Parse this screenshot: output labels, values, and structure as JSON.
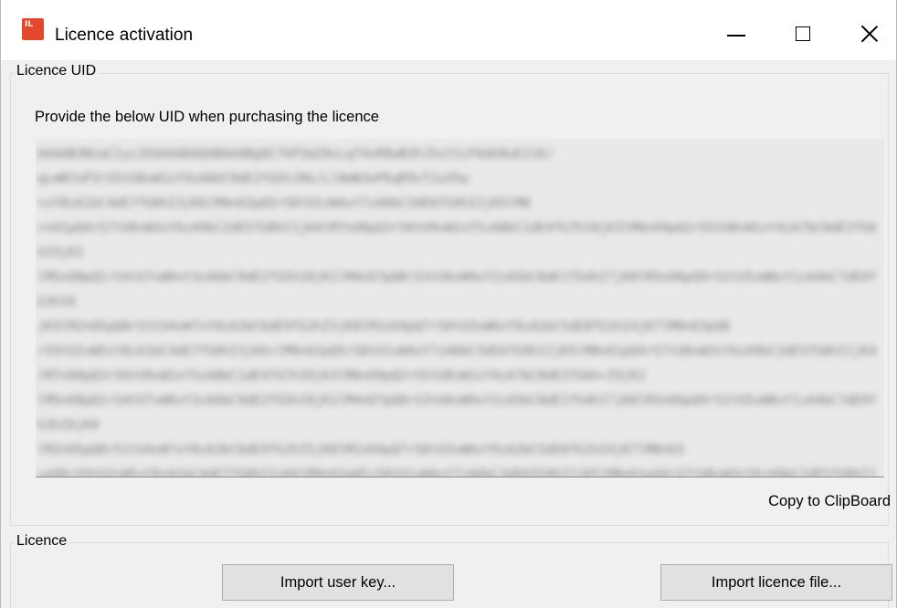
{
  "window": {
    "title": "Licence activation",
    "icon": "app-logo-icon",
    "icon_text": "IL",
    "accent_color": "#e4472c",
    "controls": [
      "minimize-icon",
      "maximize-icon",
      "close-icon"
    ]
  },
  "uid_section": {
    "legend": "Licence UID",
    "instruction": "Provide the below UID when purchasing the licence",
    "uid_value": "AAAAB3NzaC1yc2EAAAADAQABAAABgQC7kP2mZ9vLqT4xR8wN3hJ5sY1cF6dG0uE2iK/\nqLmN7oP3rS5tU8vW1xY4zA6bC9dE2fG5hJ8k/Ll0mN3oP6qR9sT2uV5w\n+xY8zA1bC4dE7fG0hI3jK6lM9nO2pQ5rS8tU1vW4xY7zA0bC3dE6fG9hI2jK5lM8\n+nO1pQ4rS7tU0vW3xY6zA9bC2dE5fG8hI1jK4lM7nO0pQ3rS6tU9vW2xY5zA8bC1dE4fG7hI0jK3lM6nO9pQ2rS5tU8vW1xY4zA7bC0dE3fG6hI9jK2\nlM5nO8pQ1rS4tU7vW0xY3zA6bC9dE2fG5hI8jK1lM4nO7pQ0rS3tU6vW9xY2zA5bC8dE1fG4hI7jK0lM3nO6pQ9rS2tU5vW8xY1zA4bC7dE0fG3hI6\njK9lM2nO5pQ8rS1tU4vW7xY0zA3bC6dE9fG2hI5jK8lM1nO4pQ7rS0tU3vW6xY9zA2bC5dE8fG1hI4jK7lM0nO3pQ6\nrS9tU2vW5xY8zA1bC4dE7fG0hI3jK6+lM9nO2pQ5rS8tU1vW4xY7zA0bC3dE6fG9hI2jK5lM8nO1pQ4rS7tU0vW3xY6zA9bC2dE5fG8hI1jK4\nlM7nO0pQ3rS6tU9vW2xY5zA8bC1dE4fG7hI0jK3lM6nO9pQ2rS5tU8vW1xY4zA7bC0dE3fG6h+I9jK2\nlM5nO8pQ1rS4tU7vW0xY3zA6bC9dE2fG5hI8jK1lM4nO7pQ0rS3tU6vW9xY2zA5bC8dE1fG4hI7jK0lM3nO6pQ9rS2tU5vW8xY1zA4bC7dE0fG3hI6jK9\nlM2nO5pQ8rS1tU4vW7xY0zA3bC6dE9fG2hI5jK8lM1nO4pQ7rS0tU3vW6xY9zA2bC5dE8fG1hI4jK7lM0nO3\n+pQ6rS9tU2vW5xY8zA1bC4dE7fG0hI3jK6lM9nO2pQ5rS8tU1vW4xY7zA0bC3dE6fG9hI2jK5lM8nO1pQ4rS7tU0vW3xY6zA9bC2dE5fG8hI1\njK4lM7nO0pQ3rS6tU9vW2xY5zA8bC1dE4fG7hI0jK3lM6nO9pQ2\nrS5tU8vW1xY4zA7bC0dE3fG6hI9jK2lM5nO8pQ1rS4tU7vW0xY3zA6bC9dE2fG5hI8jK1lM4nO7pQ0rS3tU6vW9xY2zA5bC8dE1fG4hI7jK0lM3\nnO6pQ9rS2tU5vW8xY1zA4bC7dE0fG3hI6jK9lM2nO5pQ8rS1tU4vW7xY0zA3bC6dE9",
    "copy_label": "Copy to ClipBoard"
  },
  "licence_section": {
    "legend": "Licence",
    "import_user_key_label": "Import user key...",
    "import_licence_file_label": "Import licence file..."
  }
}
